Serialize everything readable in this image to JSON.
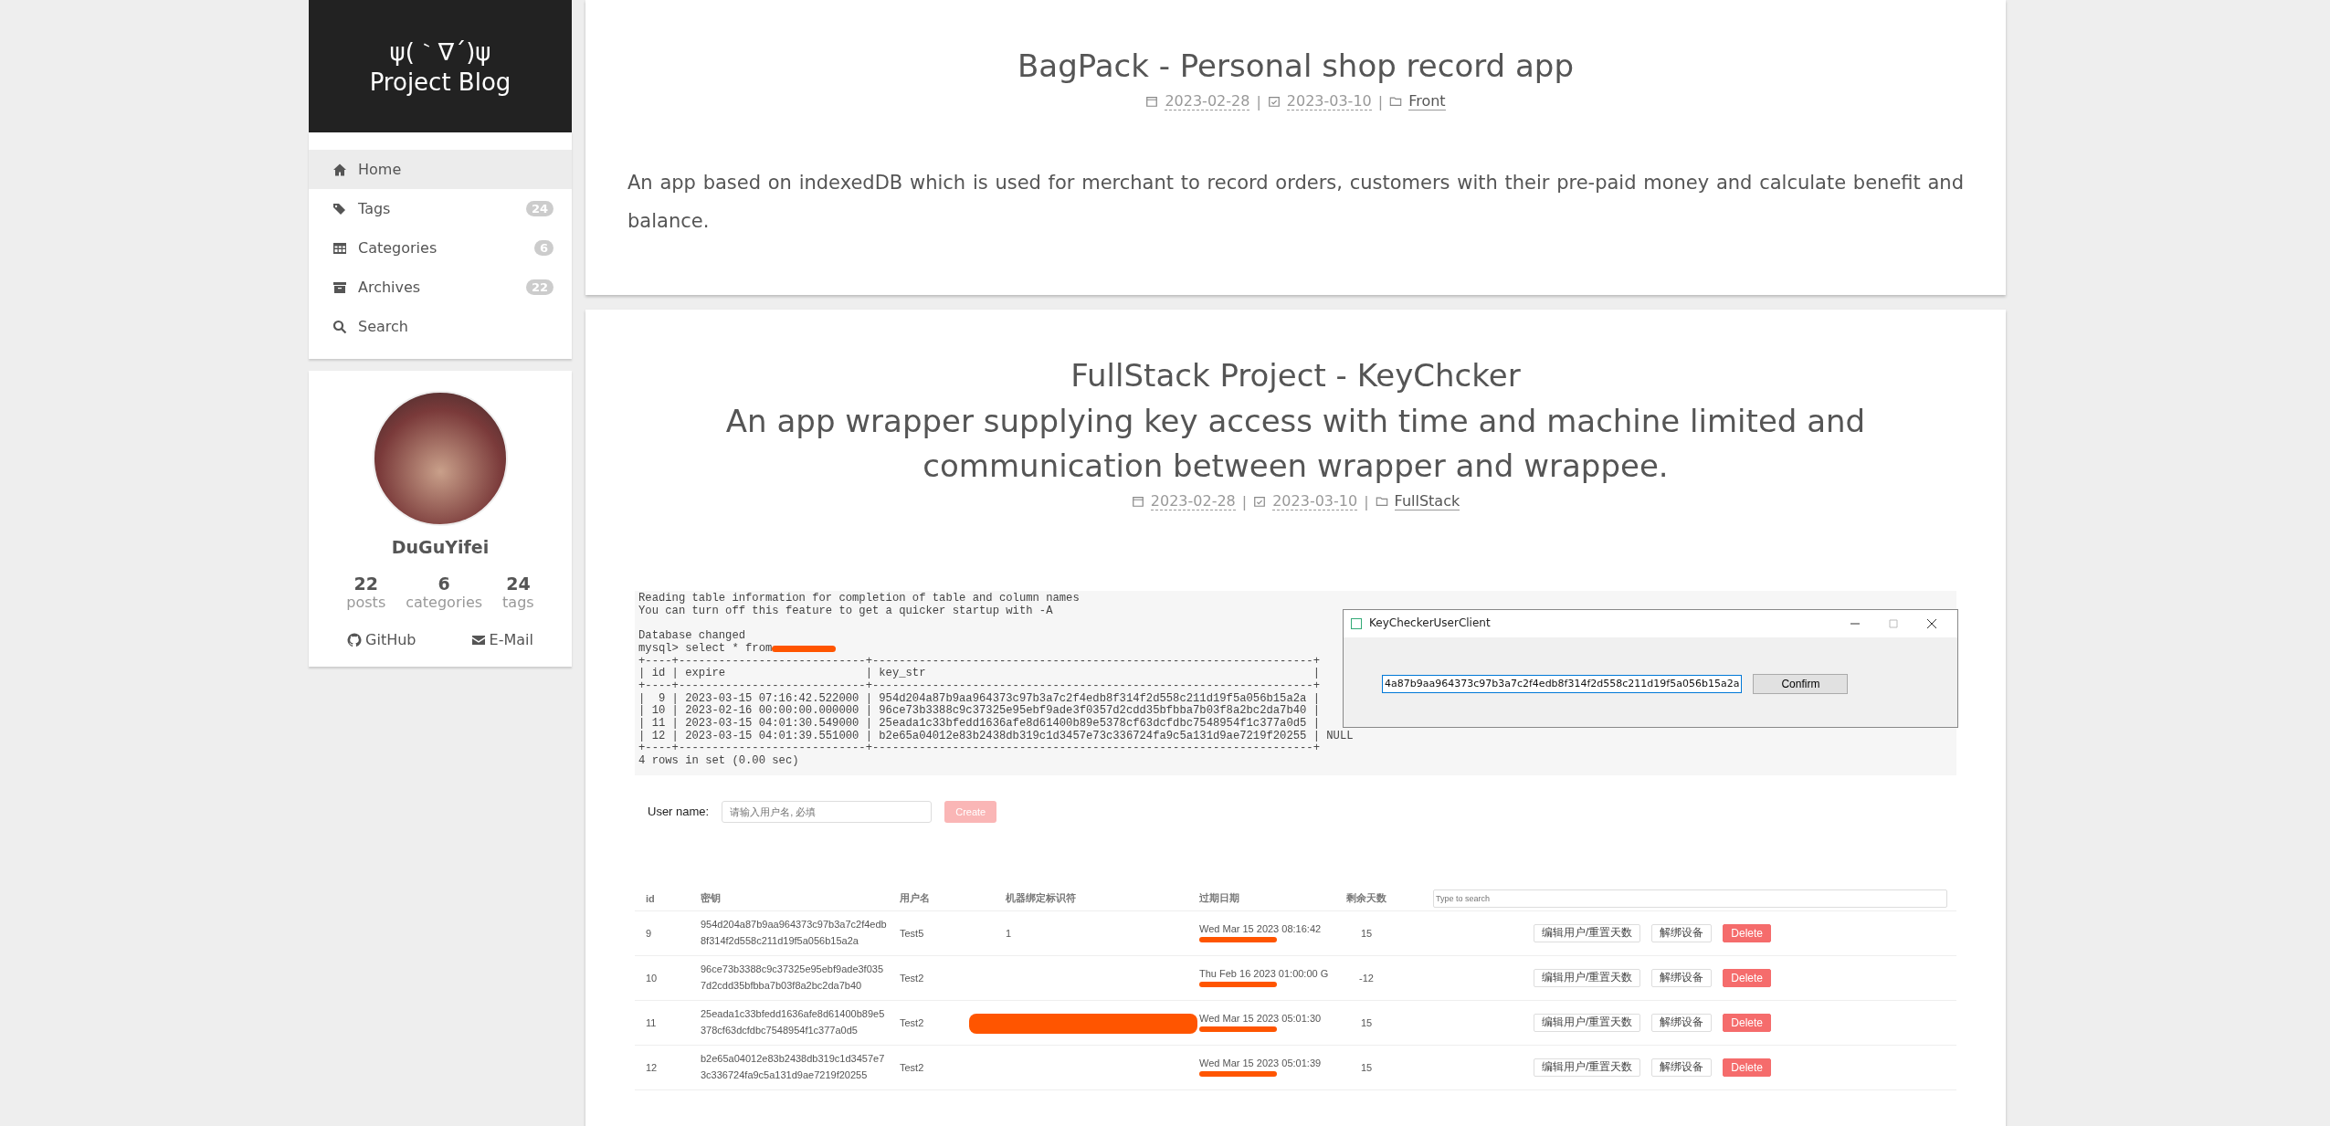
{
  "site": {
    "logo": "ψ(｀∇´)ψ",
    "title": "Project Blog"
  },
  "menu": [
    {
      "label": "Home",
      "selected": true
    },
    {
      "label": "Tags",
      "badge": "24",
      "selected": false
    },
    {
      "label": "Categories",
      "badge": "6",
      "selected": false
    },
    {
      "label": "Archives",
      "badge": "22",
      "selected": false
    },
    {
      "label": "Search",
      "selected": false
    }
  ],
  "profile": {
    "name": "DuGuYifei",
    "stats": [
      {
        "count": "22",
        "label": "posts"
      },
      {
        "count": "6",
        "label": "categories"
      },
      {
        "count": "24",
        "label": "tags"
      }
    ],
    "links": [
      {
        "label": "GitHub"
      },
      {
        "label": "E-Mail"
      }
    ]
  },
  "posts": [
    {
      "title_lines": [
        "BagPack - Personal shop record app"
      ],
      "created": "2023-02-28",
      "separators": [
        "|",
        "|"
      ],
      "updated": "2023-03-10",
      "category": "Front",
      "excerpt": "An app based on indexedDB which is used for merchant to record orders, customers with their pre-paid money and calculate benefit and balance."
    },
    {
      "title_lines": [
        "FullStack Project - KeyChcker",
        "An app wrapper supplying key access with time and machine limited and communication between wrapper and wrappee."
      ],
      "created": "2023-02-28",
      "separators": [
        "|",
        "|"
      ],
      "updated": "2023-03-10",
      "category": "FullStack",
      "terminal": {
        "lines": [
          "Reading table information for completion of table and column names",
          "You can turn off this feature to get a quicker startup with -A",
          "Database changed",
          "mysql> select * from"
        ],
        "table_lines": [
          "+----+----------------------------+------------------------------------------------------------------+",
          "| id | expire                     | key_str                                                          |",
          "+----+----------------------------+------------------------------------------------------------------+",
          "|  9 | 2023-03-15 07:16:42.522000 | 954d204a87b9aa964373c97b3a7c2f4edb8f314f2d558c211d19f5a056b15a2a |",
          "| 10 | 2023-02-16 00:00:00.000000 | 96ce73b3388c9c37325e95ebf9ade3f0357d2cdd35bfbba7b03f8a2bc2da7b40 |",
          "| 11 | 2023-03-15 04:01:30.549000 | 25eada1c33bfedd1636afe8d61400b89e5378cf63dcfdbc7548954f1c377a0d5 |",
          "| 12 | 2023-03-15 04:01:39.551000 | b2e65a04012e83b2438db319c1d3457e73c336724fa9c5a131d9ae7219f20255 | NULL",
          "+----+----------------------------+------------------------------------------------------------------+",
          "4 rows in set (0.00 sec)"
        ],
        "window": {
          "title": "KeyCheckerUserClient",
          "key": "4a87b9aa964373c97b3a7c2f4edb8f314f2d558c211d19f5a056b15a2a",
          "button": "Confirm"
        }
      },
      "form": {
        "label": "User name:",
        "placeholder": "请输入用户名, 必填",
        "button": "Create"
      },
      "table": {
        "columns": [
          "id",
          "密钥",
          "用户名",
          "机器绑定标识符",
          "过期日期",
          "剩余天数"
        ],
        "search_placeholder": "Type to search",
        "rows": [
          {
            "id": "9",
            "key": "954d204a87b9aa964373c97b3a7c2f4edb8f314f2d558c211d19f5a056b15a2a",
            "user": "Test5",
            "machine": "1",
            "expiry": "Wed Mar 15 2023 08:16:42",
            "days": "15",
            "actions": [
              "编辑用户/重置天数",
              "解绑设备",
              "Delete"
            ]
          },
          {
            "id": "10",
            "key": "96ce73b3388c9c37325e95ebf9ade3f0357d2cdd35bfbba7b03f8a2bc2da7b40",
            "user": "Test2",
            "machine": "",
            "expiry": "Thu Feb 16 2023 01:00:00 G",
            "days": "-12",
            "actions": [
              "编辑用户/重置天数",
              "解绑设备",
              "Delete"
            ]
          },
          {
            "id": "11",
            "key": "25eada1c33bfedd1636afe8d61400b89e5378cf63dcfdbc7548954f1c377a0d5",
            "user": "Test2",
            "machine": "",
            "expiry": "Wed Mar 15 2023 05:01:30",
            "days": "15",
            "actions": [
              "编辑用户/重置天数",
              "解绑设备",
              "Delete"
            ]
          },
          {
            "id": "12",
            "key": "b2e65a04012e83b2438db319c1d3457e73c336724fa9c5a131d9ae7219f20255",
            "user": "Test2",
            "machine": "",
            "expiry": "Wed Mar 15 2023 05:01:39",
            "days": "15",
            "actions": [
              "编辑用户/重置天数",
              "解绑设备",
              "Delete"
            ]
          }
        ]
      }
    }
  ]
}
